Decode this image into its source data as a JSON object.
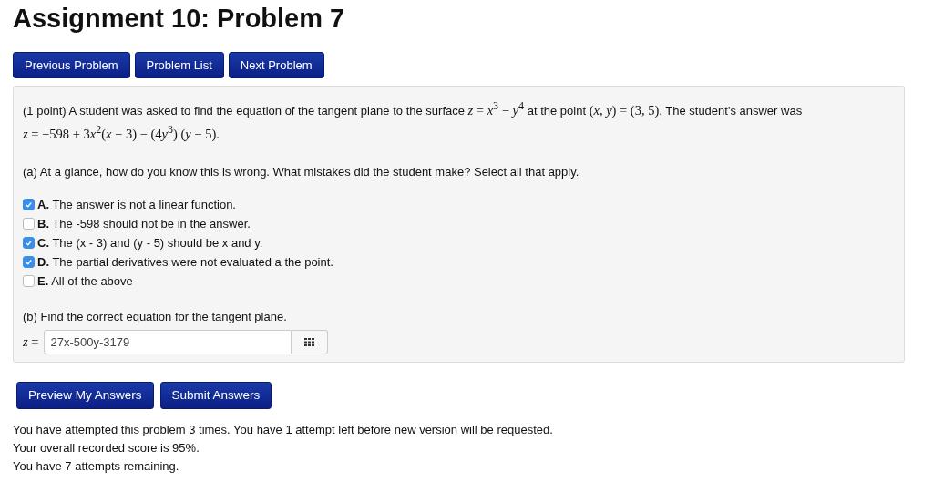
{
  "title": "Assignment 10: Problem 7",
  "nav_buttons": [
    "Previous Problem",
    "Problem List",
    "Next Problem"
  ],
  "problem": {
    "intro": [
      {
        "kind": "text",
        "s": "(1 point) A student was asked to find the equation of the tangent plane to the surface "
      },
      {
        "kind": "math",
        "s": "*z* = *x*$^{3}$ − *y*$^{4}$"
      },
      {
        "kind": "text",
        "s": " at the point "
      },
      {
        "kind": "math",
        "s": "(*x*, *y*) = (3, 5)"
      },
      {
        "kind": "text",
        "s": ". The student's answer was "
      },
      {
        "kind": "math",
        "s": "*z* = −598 + 3",
        "more": [
          "*x*$^{2}$(*x* − 3) − (4",
          "*y*$^{3}$) (*y* − 5)."
        ]
      }
    ],
    "part_a": "(a) At a glance, how do you know this is wrong. What mistakes did the student make? Select all that apply.",
    "options": [
      {
        "text": "**A.** The answer is not a linear function.",
        "checked": true
      },
      {
        "text": "**B.** The -598 should not be in the answer.",
        "checked": false
      },
      {
        "text": "**C.** The (x - 3) and (y - 5) should be x and y.",
        "checked": true
      },
      {
        "text": "**D.** The partial derivatives were not evaluated a the point.",
        "checked": true
      },
      {
        "text": "**E.** All of the above",
        "checked": false
      }
    ],
    "part_b": "(b) Find the correct equation for the tangent plane.",
    "answer_label": "*z* =",
    "answer_value": "27x-500y-3179"
  },
  "action_buttons": [
    "Preview My Answers",
    "Submit Answers"
  ],
  "messages": [
    "You have attempted this problem 3 times. You have 1 attempt left before new version will be requested.",
    "Your overall recorded score is 95%.",
    "You have 7 attempts remaining."
  ]
}
